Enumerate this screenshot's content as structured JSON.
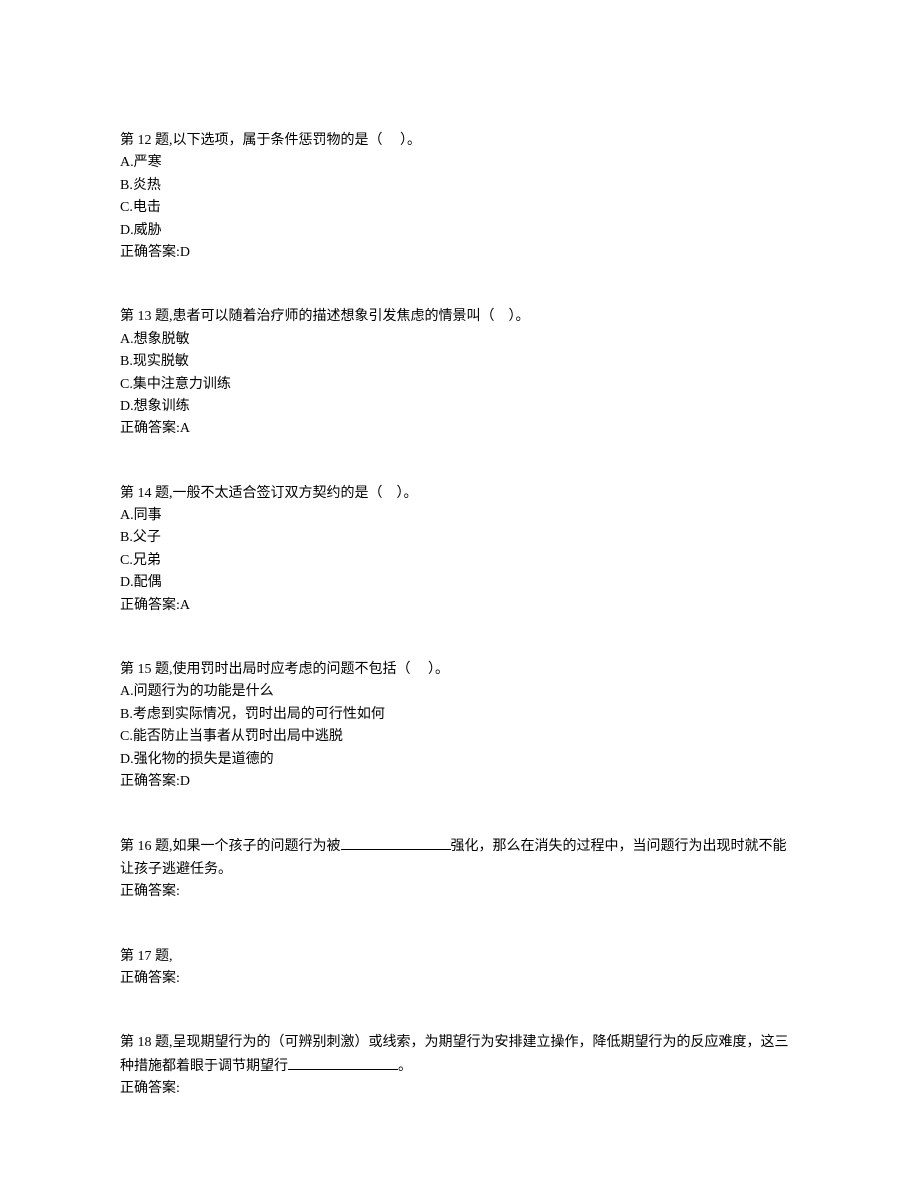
{
  "q12": {
    "title": "第 12 题,以下选项，属于条件惩罚物的是（     ）。",
    "A": "A.严寒",
    "B": "B.炎热",
    "C": "C.电击",
    "D": "D.威胁",
    "answer": "正确答案:D"
  },
  "q13": {
    "title": "第 13 题,患者可以随着治疗师的描述想象引发焦虑的情景叫（    ）。",
    "A": "A.想象脱敏",
    "B": "B.现实脱敏",
    "C": "C.集中注意力训练",
    "D": "D.想象训练",
    "answer": "正确答案:A"
  },
  "q14": {
    "title": "第 14 题,一般不太适合签订双方契约的是（    ）。",
    "A": "A.同事",
    "B": "B.父子",
    "C": "C.兄弟",
    "D": "D.配偶",
    "answer": "正确答案:A"
  },
  "q15": {
    "title": "第 15 题,使用罚时出局时应考虑的问题不包括（     ）。",
    "A": "A.问题行为的功能是什么",
    "B": "B.考虑到实际情况，罚时出局的可行性如何",
    "C": "C.能否防止当事者从罚时出局中逃脱",
    "D": "D.强化物的损失是道德的",
    "answer": "正确答案:D"
  },
  "q16": {
    "title_pre": "第 16 题,如果一个孩子的问题行为被",
    "title_post": "强化，那么在消失的过程中，当问题行为出现时就不能让孩子逃避任务。",
    "answer": "正确答案:"
  },
  "q17": {
    "title": "第 17 题,",
    "answer": "正确答案:"
  },
  "q18": {
    "title_pre": "第 18 题,呈现期望行为的（可辨别刺激）或线索，为期望行为安排建立操作，降低期望行为的反应难度，这三种措施都着眼于调节期望行",
    "title_post": "。",
    "answer": "正确答案:"
  }
}
